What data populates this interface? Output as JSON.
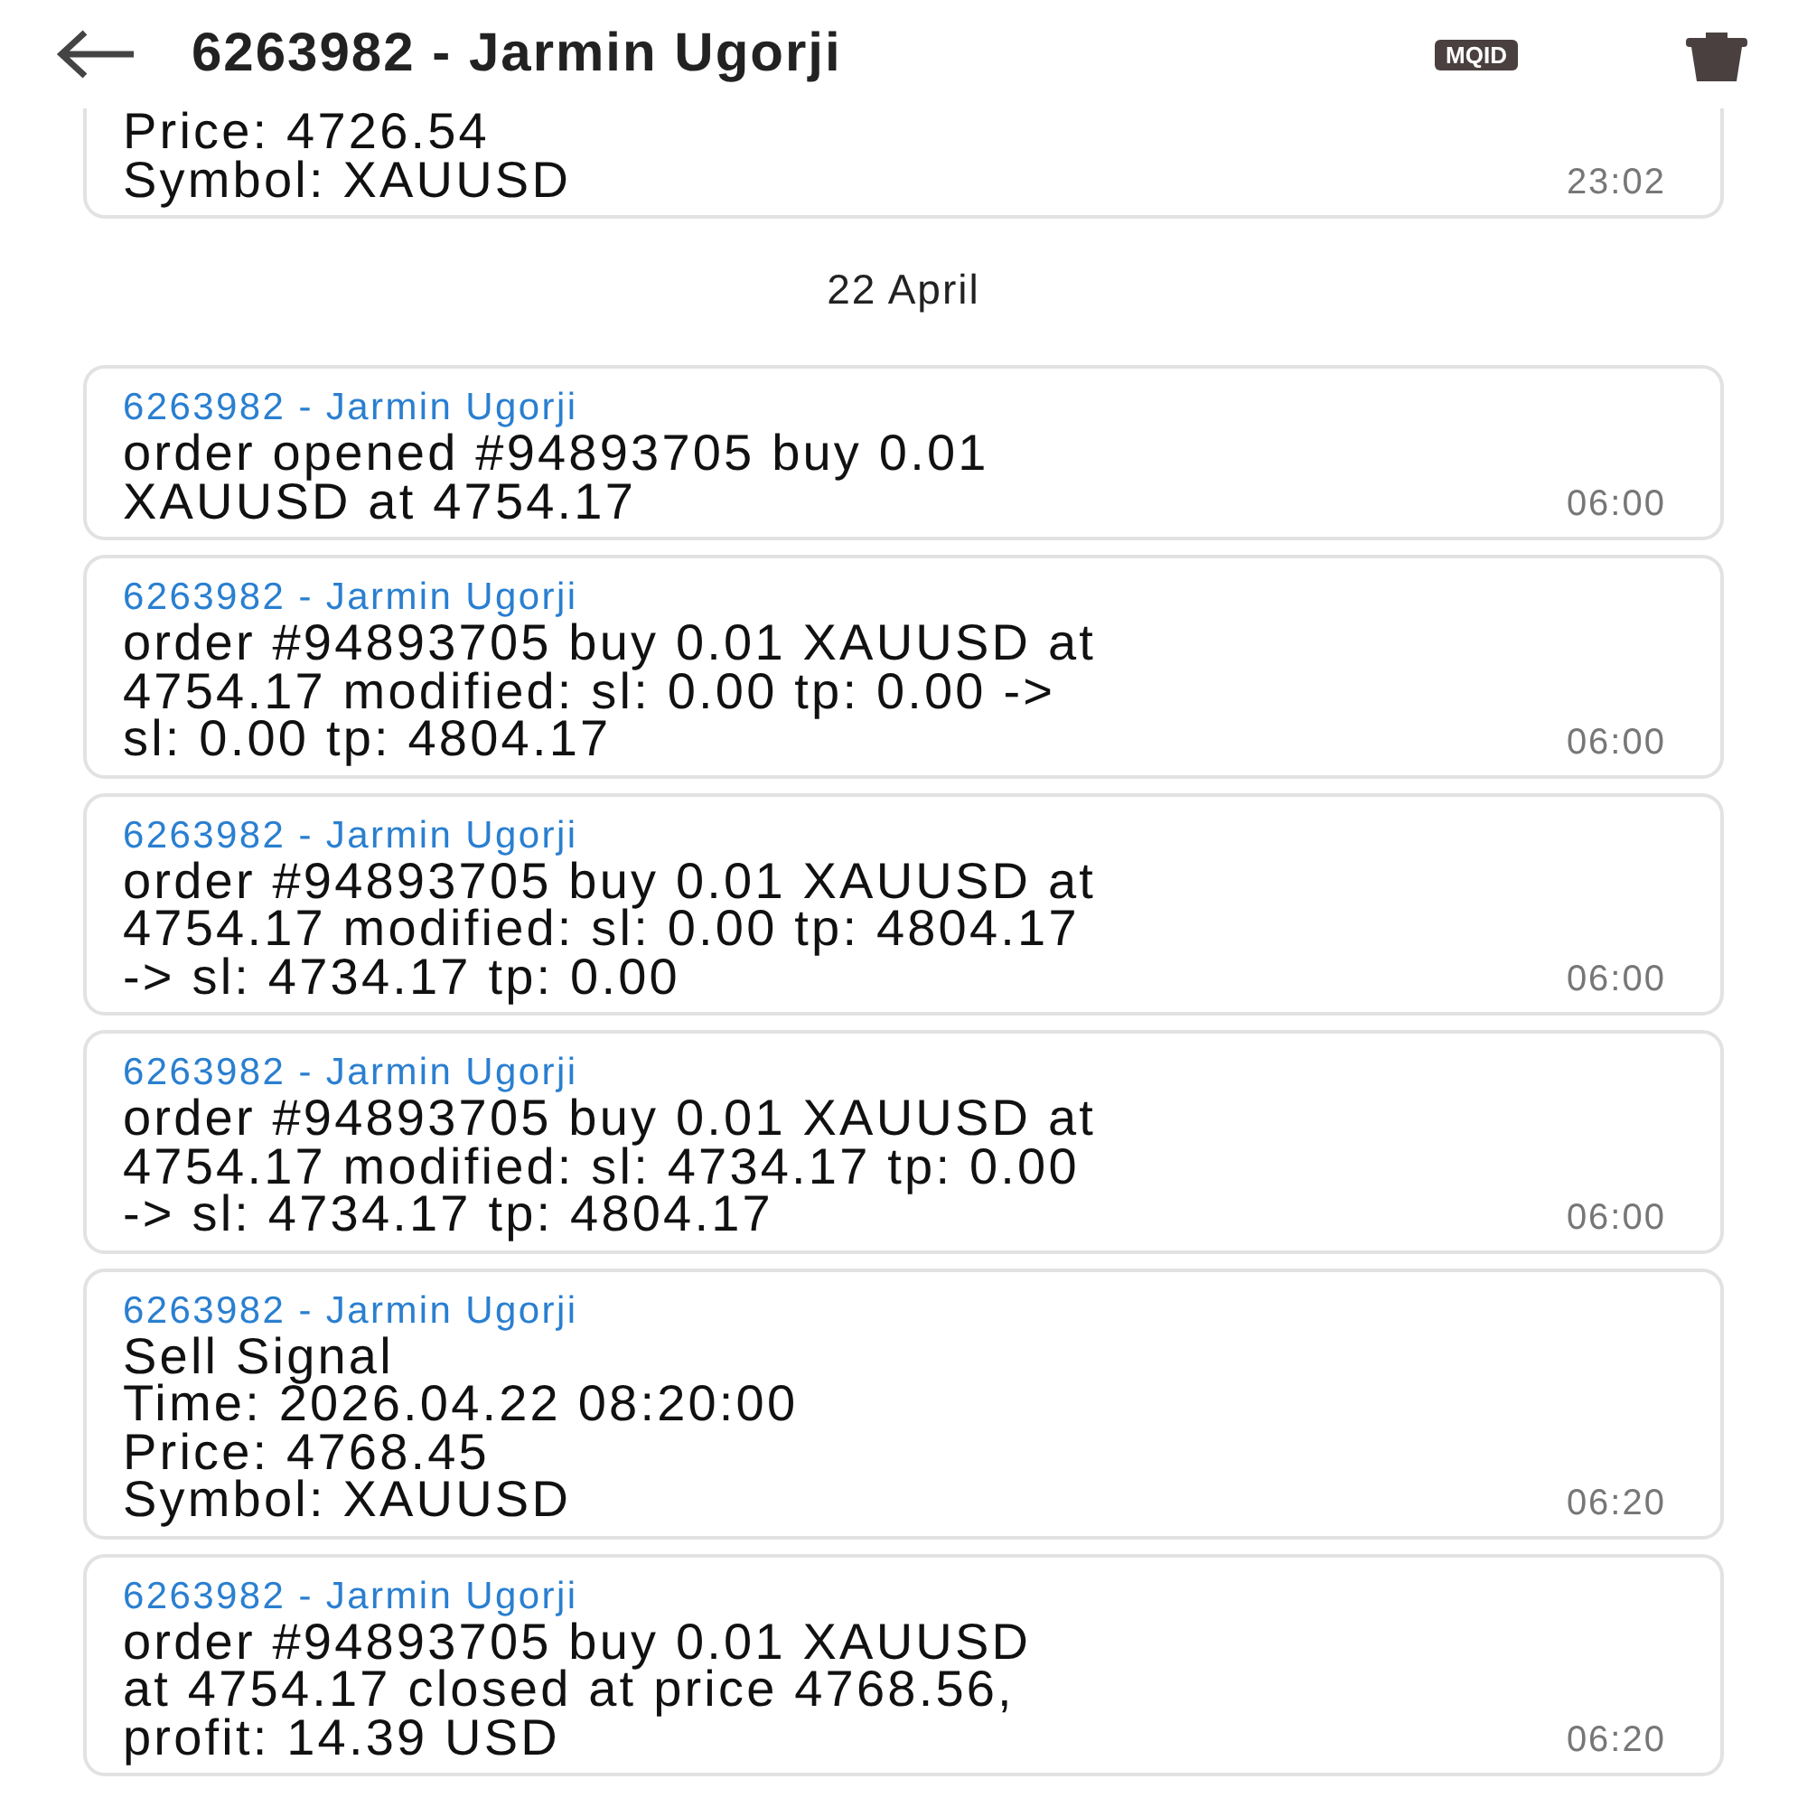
{
  "header": {
    "title": "6263982 - Jarmin Ugorji",
    "badge": "MQID"
  },
  "messages": [
    {
      "kind": "cut",
      "lines": [
        "Price: 4726.54",
        "Symbol: XAUUSD"
      ],
      "time": "23:02"
    },
    {
      "kind": "date",
      "label": "22 April"
    },
    {
      "kind": "message",
      "sender": "6263982 - Jarmin Ugorji",
      "lines": [
        "order opened #94893705 buy 0.01",
        "XAUUSD at 4754.17"
      ],
      "time": "06:00"
    },
    {
      "kind": "message",
      "sender": "6263982 - Jarmin Ugorji",
      "lines": [
        "order #94893705 buy 0.01 XAUUSD at",
        "4754.17 modified: sl: 0.00 tp: 0.00 ->",
        "sl: 0.00 tp: 4804.17"
      ],
      "time": "06:00"
    },
    {
      "kind": "message",
      "sender": "6263982 - Jarmin Ugorji",
      "lines": [
        "order #94893705 buy 0.01 XAUUSD at",
        "4754.17 modified: sl: 0.00 tp: 4804.17",
        "-> sl: 4734.17 tp: 0.00"
      ],
      "time": "06:00"
    },
    {
      "kind": "message",
      "sender": "6263982 - Jarmin Ugorji",
      "lines": [
        "order #94893705 buy 0.01 XAUUSD at",
        "4754.17 modified: sl: 4734.17 tp: 0.00",
        "-> sl: 4734.17 tp: 4804.17"
      ],
      "time": "06:00"
    },
    {
      "kind": "message",
      "sender": "6263982 - Jarmin Ugorji",
      "lines": [
        "Sell Signal",
        "Time: 2026.04.22 08:20:00",
        "Price: 4768.45",
        "Symbol: XAUUSD"
      ],
      "time": "06:20"
    },
    {
      "kind": "message",
      "sender": "6263982 - Jarmin Ugorji",
      "lines": [
        "order #94893705 buy 0.01 XAUUSD",
        "at 4754.17 closed at price 4768.56,",
        "profit: 14.39 USD"
      ],
      "time": "06:20"
    }
  ]
}
